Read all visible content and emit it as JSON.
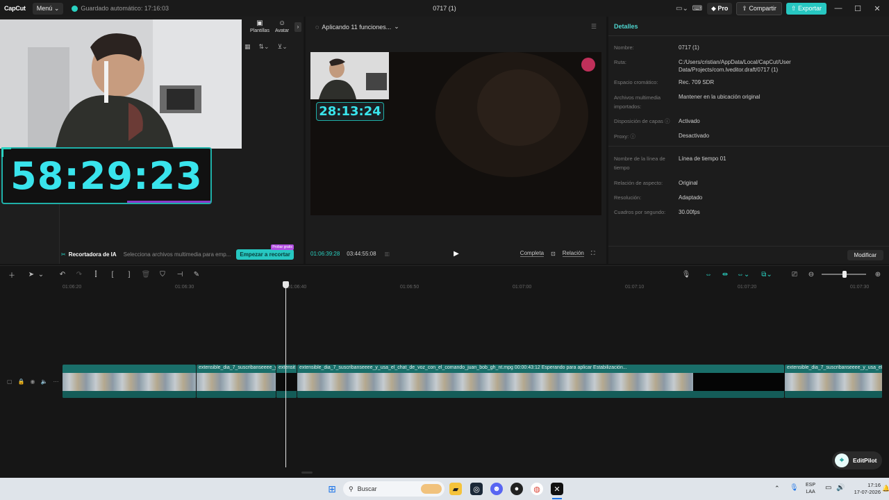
{
  "titlebar": {
    "logo": "CapCut",
    "menu_label": "Menú",
    "autosave": "Guardado automático: 17:16:03",
    "title": "0717 (1)",
    "pro_label": "Pro",
    "share_label": "Compartir",
    "export_label": "Exportar"
  },
  "left_panel": {
    "tabs": [
      {
        "label": "e"
      },
      {
        "label": "Plantillas"
      },
      {
        "label": "Avatar"
      }
    ],
    "timer_overlay": "58:29:23",
    "ai_bar": {
      "title": "Recortadora de IA",
      "description": "Selecciona archivos multimedia para emp...",
      "badge": "Probar gratis",
      "button": "Empezar a recortar"
    }
  },
  "player": {
    "status": "Aplicando 11 funciones...",
    "pip_timer": "28:13:24",
    "current_time": "01:06:39:28",
    "total_time": "03:44:55:08",
    "full_label": "Completa",
    "ratio_label": "Relación"
  },
  "details": {
    "title": "Detalles",
    "rows": [
      {
        "label": "Nombre:",
        "value": "0717 (1)"
      },
      {
        "label": "Ruta:",
        "value": "C:/Users/cristian/AppData/Local/CapCut/User Data/Projects/com.lveditor.draft/0717 (1)"
      },
      {
        "label": "Espacio cromático:",
        "value": "Rec. 709 SDR"
      },
      {
        "label": "Archivos multimedia importados:",
        "value": "Mantener en la ubicación original"
      },
      {
        "label": "Disposición de capas",
        "value": "Activado"
      },
      {
        "label": "Proxy:",
        "value": "Desactivado"
      },
      {
        "label": "Nombre de la línea de tiempo",
        "value": "Línea de tiempo 01"
      },
      {
        "label": "Relación de aspecto:",
        "value": "Original"
      },
      {
        "label": "Resolución:",
        "value": "Adaptado"
      },
      {
        "label": "Cuadros por segundo:",
        "value": "30.00fps"
      }
    ],
    "modify_label": "Modificar"
  },
  "timeline": {
    "ruler": [
      "01:06:20",
      "01:06:30",
      "01:06:40",
      "01:06:50",
      "01:07:00",
      "01:07:10",
      "01:07:20",
      "01:07:30"
    ],
    "clips": [
      {
        "label": ""
      },
      {
        "label": "extensible_dia_7_suscribanseeee_y_usa"
      },
      {
        "label": "extensit"
      },
      {
        "label": "extensible_dia_7_suscribanseeee_y_usa_el_chat_de_voz_con_el_comando_juan_bob_gh_nt.mpg   00:00:43:12   Esperando para aplicar Estabilización..."
      },
      {
        "label": "extensible_dia_7_suscribanseeee_y_usa_el_chi"
      }
    ],
    "editpilot_label": "EditPilot"
  },
  "taskbar": {
    "search_placeholder": "Buscar",
    "lang_top": "ESP",
    "lang_bottom": "LAA",
    "time": "17:16",
    "date": "17-07-2026"
  }
}
